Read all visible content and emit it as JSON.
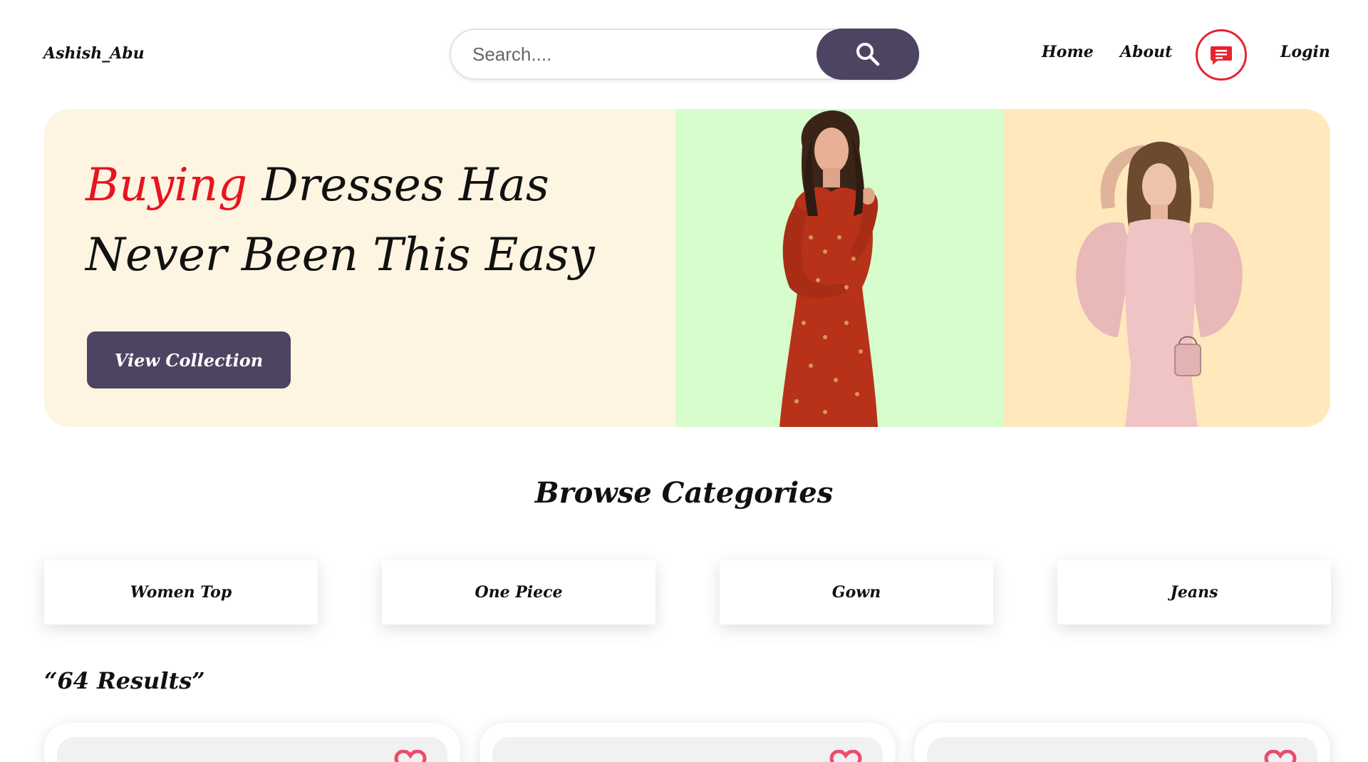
{
  "header": {
    "brand": "Ashish_Abu",
    "search_placeholder": "Search....",
    "nav": {
      "home": "Home",
      "about": "About",
      "login": "Login"
    }
  },
  "hero": {
    "title_accent": "Buying",
    "title_rest_line1": " Dresses Has",
    "title_line2": "Never Been This Easy",
    "button_label": "View Collection",
    "colors": {
      "left": "#fdf5e1",
      "middle": "#d6fdcb",
      "right": "#ffe8bc",
      "accent": "#e8141f",
      "button": "#4d4462"
    }
  },
  "categories": {
    "title": "Browse Categories",
    "items": [
      "Women Top",
      "One Piece",
      "Gown",
      "Jeans"
    ]
  },
  "results": {
    "label": "“64 Results”"
  },
  "icons": {
    "search": "search-icon",
    "chat": "chat-icon",
    "favorite": "heart-icon"
  }
}
